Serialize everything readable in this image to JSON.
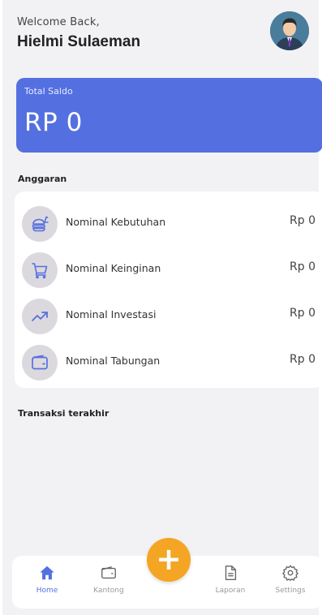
{
  "header": {
    "welcome": "Welcome Back,",
    "username": "Hielmi Sulaeman"
  },
  "saldo": {
    "label": "Total Saldo",
    "value": "RP 0"
  },
  "anggaran": {
    "title": "Anggaran",
    "items": [
      {
        "icon": "food-icon",
        "label": "Nominal Kebutuhan",
        "value": "Rp 0"
      },
      {
        "icon": "cart-icon",
        "label": "Nominal Keinginan",
        "value": "Rp 0"
      },
      {
        "icon": "trending-up-icon",
        "label": "Nominal Investasi",
        "value": "Rp 0"
      },
      {
        "icon": "wallet-icon",
        "label": "Nominal Tabungan",
        "value": "Rp 0"
      }
    ]
  },
  "transaksi": {
    "title": "Transaksi terakhir"
  },
  "nav": {
    "items": [
      {
        "icon": "home-icon",
        "label": "Home",
        "active": true
      },
      {
        "icon": "wallet-icon",
        "label": "Kantong",
        "active": false
      },
      {
        "icon": "report-icon",
        "label": "Laporan",
        "active": false
      },
      {
        "icon": "settings-icon",
        "label": "Settings",
        "active": false
      }
    ],
    "fab_icon": "plus-icon",
    "fab_label": "+"
  },
  "colors": {
    "accent": "#5470e0",
    "fab": "#f5a524",
    "background": "#f2f2f4",
    "icon_bg": "#dcd9de"
  }
}
